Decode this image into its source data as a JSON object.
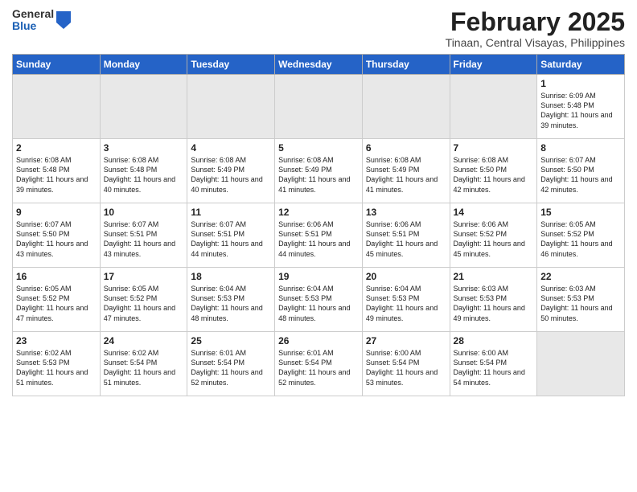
{
  "header": {
    "logo_general": "General",
    "logo_blue": "Blue",
    "month_title": "February 2025",
    "location": "Tinaan, Central Visayas, Philippines"
  },
  "days_of_week": [
    "Sunday",
    "Monday",
    "Tuesday",
    "Wednesday",
    "Thursday",
    "Friday",
    "Saturday"
  ],
  "weeks": [
    {
      "days": [
        {
          "num": "",
          "info": ""
        },
        {
          "num": "",
          "info": ""
        },
        {
          "num": "",
          "info": ""
        },
        {
          "num": "",
          "info": ""
        },
        {
          "num": "",
          "info": ""
        },
        {
          "num": "",
          "info": ""
        },
        {
          "num": "1",
          "info": "Sunrise: 6:09 AM\nSunset: 5:48 PM\nDaylight: 11 hours and 39 minutes."
        }
      ]
    },
    {
      "days": [
        {
          "num": "2",
          "info": "Sunrise: 6:08 AM\nSunset: 5:48 PM\nDaylight: 11 hours and 39 minutes."
        },
        {
          "num": "3",
          "info": "Sunrise: 6:08 AM\nSunset: 5:48 PM\nDaylight: 11 hours and 40 minutes."
        },
        {
          "num": "4",
          "info": "Sunrise: 6:08 AM\nSunset: 5:49 PM\nDaylight: 11 hours and 40 minutes."
        },
        {
          "num": "5",
          "info": "Sunrise: 6:08 AM\nSunset: 5:49 PM\nDaylight: 11 hours and 41 minutes."
        },
        {
          "num": "6",
          "info": "Sunrise: 6:08 AM\nSunset: 5:49 PM\nDaylight: 11 hours and 41 minutes."
        },
        {
          "num": "7",
          "info": "Sunrise: 6:08 AM\nSunset: 5:50 PM\nDaylight: 11 hours and 42 minutes."
        },
        {
          "num": "8",
          "info": "Sunrise: 6:07 AM\nSunset: 5:50 PM\nDaylight: 11 hours and 42 minutes."
        }
      ]
    },
    {
      "days": [
        {
          "num": "9",
          "info": "Sunrise: 6:07 AM\nSunset: 5:50 PM\nDaylight: 11 hours and 43 minutes."
        },
        {
          "num": "10",
          "info": "Sunrise: 6:07 AM\nSunset: 5:51 PM\nDaylight: 11 hours and 43 minutes."
        },
        {
          "num": "11",
          "info": "Sunrise: 6:07 AM\nSunset: 5:51 PM\nDaylight: 11 hours and 44 minutes."
        },
        {
          "num": "12",
          "info": "Sunrise: 6:06 AM\nSunset: 5:51 PM\nDaylight: 11 hours and 44 minutes."
        },
        {
          "num": "13",
          "info": "Sunrise: 6:06 AM\nSunset: 5:51 PM\nDaylight: 11 hours and 45 minutes."
        },
        {
          "num": "14",
          "info": "Sunrise: 6:06 AM\nSunset: 5:52 PM\nDaylight: 11 hours and 45 minutes."
        },
        {
          "num": "15",
          "info": "Sunrise: 6:05 AM\nSunset: 5:52 PM\nDaylight: 11 hours and 46 minutes."
        }
      ]
    },
    {
      "days": [
        {
          "num": "16",
          "info": "Sunrise: 6:05 AM\nSunset: 5:52 PM\nDaylight: 11 hours and 47 minutes."
        },
        {
          "num": "17",
          "info": "Sunrise: 6:05 AM\nSunset: 5:52 PM\nDaylight: 11 hours and 47 minutes."
        },
        {
          "num": "18",
          "info": "Sunrise: 6:04 AM\nSunset: 5:53 PM\nDaylight: 11 hours and 48 minutes."
        },
        {
          "num": "19",
          "info": "Sunrise: 6:04 AM\nSunset: 5:53 PM\nDaylight: 11 hours and 48 minutes."
        },
        {
          "num": "20",
          "info": "Sunrise: 6:04 AM\nSunset: 5:53 PM\nDaylight: 11 hours and 49 minutes."
        },
        {
          "num": "21",
          "info": "Sunrise: 6:03 AM\nSunset: 5:53 PM\nDaylight: 11 hours and 49 minutes."
        },
        {
          "num": "22",
          "info": "Sunrise: 6:03 AM\nSunset: 5:53 PM\nDaylight: 11 hours and 50 minutes."
        }
      ]
    },
    {
      "days": [
        {
          "num": "23",
          "info": "Sunrise: 6:02 AM\nSunset: 5:53 PM\nDaylight: 11 hours and 51 minutes."
        },
        {
          "num": "24",
          "info": "Sunrise: 6:02 AM\nSunset: 5:54 PM\nDaylight: 11 hours and 51 minutes."
        },
        {
          "num": "25",
          "info": "Sunrise: 6:01 AM\nSunset: 5:54 PM\nDaylight: 11 hours and 52 minutes."
        },
        {
          "num": "26",
          "info": "Sunrise: 6:01 AM\nSunset: 5:54 PM\nDaylight: 11 hours and 52 minutes."
        },
        {
          "num": "27",
          "info": "Sunrise: 6:00 AM\nSunset: 5:54 PM\nDaylight: 11 hours and 53 minutes."
        },
        {
          "num": "28",
          "info": "Sunrise: 6:00 AM\nSunset: 5:54 PM\nDaylight: 11 hours and 54 minutes."
        },
        {
          "num": "",
          "info": ""
        }
      ]
    }
  ]
}
